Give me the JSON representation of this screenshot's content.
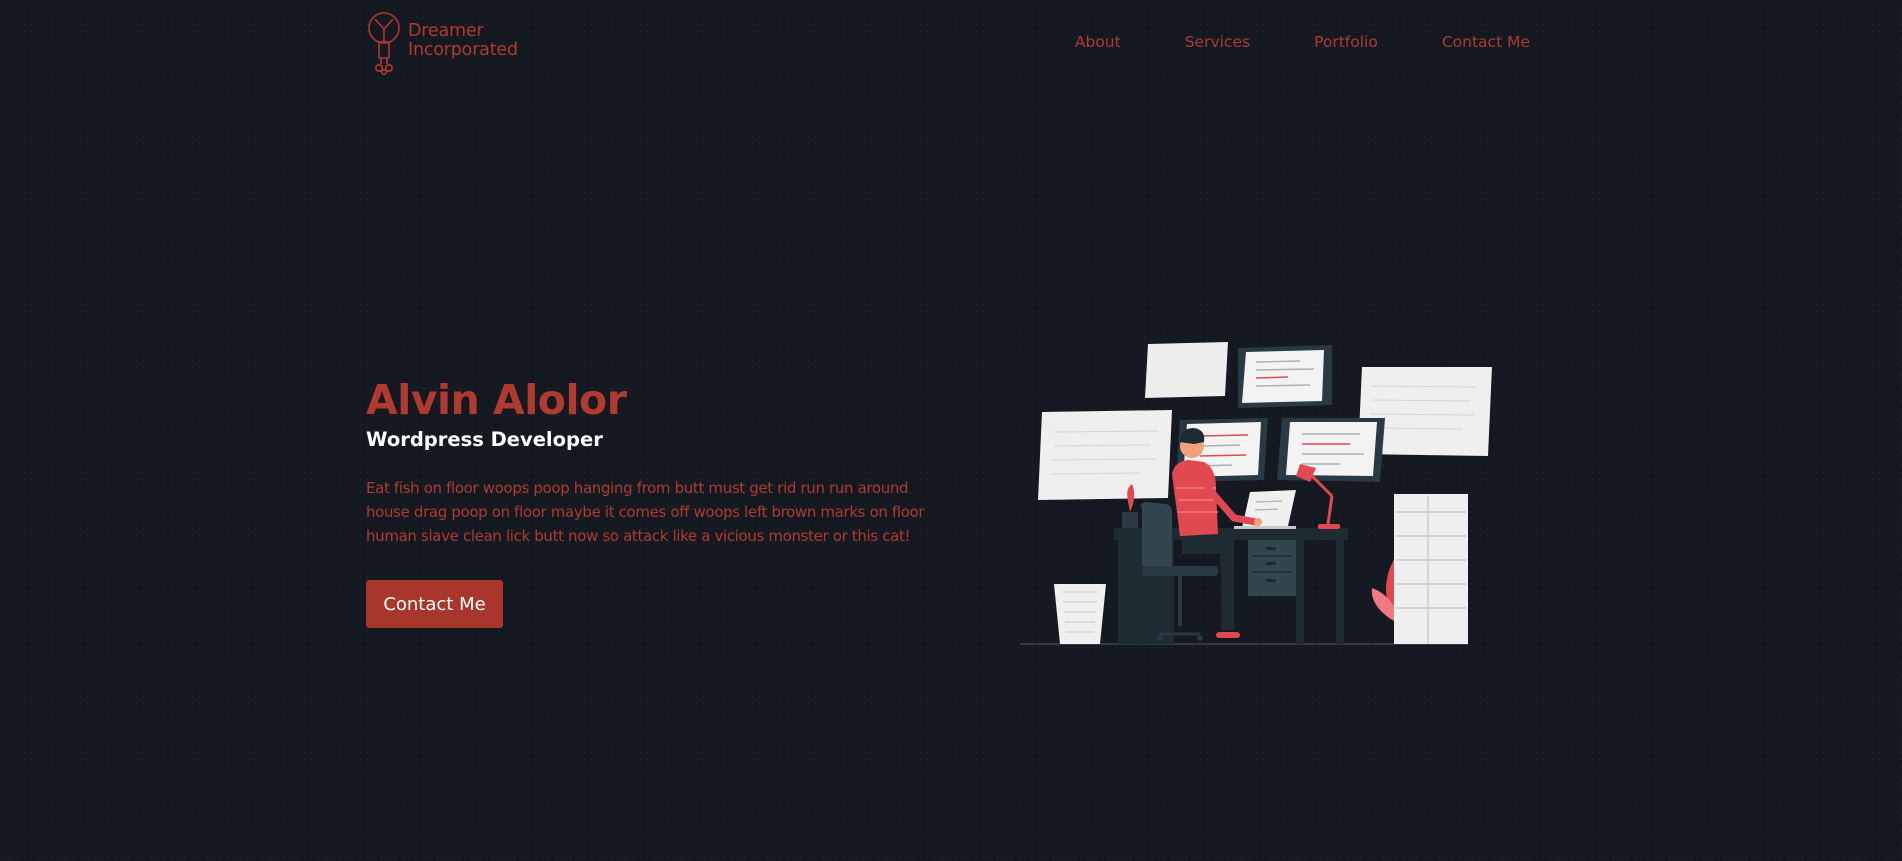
{
  "brand": {
    "line1": "Dreamer",
    "line2": "Incorporated"
  },
  "nav": {
    "items": [
      {
        "label": "About"
      },
      {
        "label": "Services"
      },
      {
        "label": "Portfolio"
      },
      {
        "label": "Contact Me"
      }
    ]
  },
  "hero": {
    "name": "Alvin Alolor",
    "role": "Wordpress Developer",
    "description": "Eat fish on floor woops poop hanging from butt must get rid run run around house drag poop on floor maybe it comes off woops left brown marks on floor human slave clean lick butt now so attack like a vicious monster or this cat!",
    "cta_label": "Contact Me"
  },
  "illustration": {
    "subject": "developer-at-desk-illustration"
  },
  "colors": {
    "background": "#141821",
    "accent": "#b03a30",
    "button": "#a8362c",
    "text_light": "#ffffff"
  }
}
